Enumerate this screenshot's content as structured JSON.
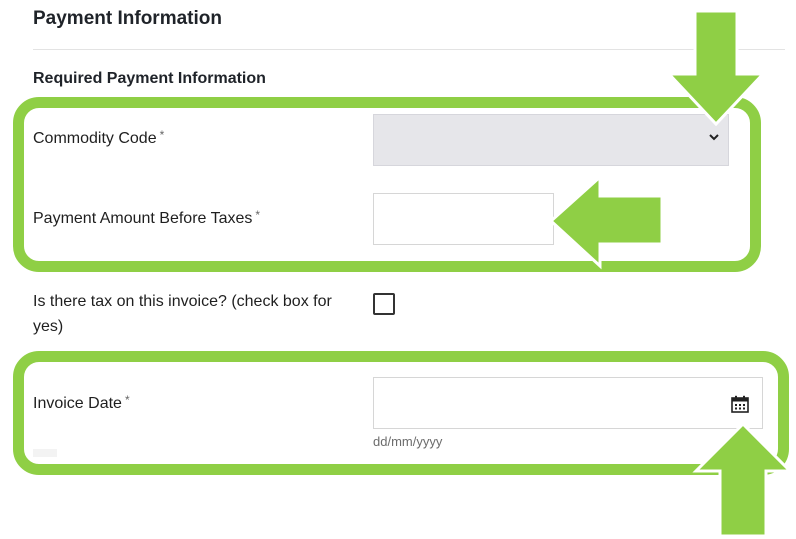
{
  "form": {
    "section_title": "Payment Information",
    "subsection_title": "Required Payment Information",
    "commodity_code": {
      "label": "Commodity Code",
      "required_mark": "*",
      "value": ""
    },
    "payment_amount": {
      "label": "Payment Amount Before Taxes",
      "required_mark": "*",
      "value": ""
    },
    "tax_checkbox": {
      "label": "Is there tax on this invoice? (check box for yes)",
      "checked": false
    },
    "invoice_date": {
      "label": "Invoice Date",
      "required_mark": "*",
      "value": "",
      "format_hint": "dd/mm/yyyy"
    }
  },
  "icons": {
    "dropdown": "chevron-down-icon",
    "date_picker": "calendar-icon",
    "annotation_arrow": "arrow-icon"
  },
  "colors": {
    "highlight_green": "#8fcf45",
    "select_background": "#e6e6ea"
  }
}
